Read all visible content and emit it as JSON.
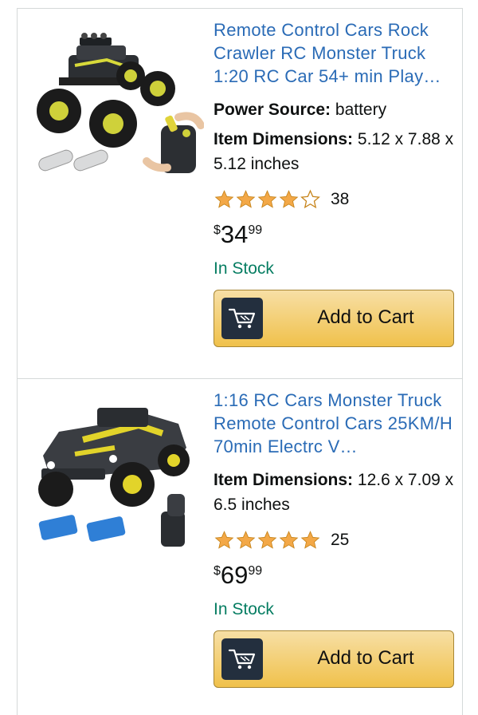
{
  "products": [
    {
      "title": "Remote Control Cars Rock Crawler RC Monster Truck 1:20 RC Car 54+ min Play…",
      "specs": [
        {
          "label": "Power Source:",
          "value": "battery"
        },
        {
          "label": "Item Dimensions:",
          "value": "5.12 x 7.88 x 5.12 inches"
        }
      ],
      "rating_stars": 4,
      "rating_count": "38",
      "price": {
        "currency": "$",
        "whole": "34",
        "fraction": "99"
      },
      "stock": "In Stock",
      "cart_label": "Add to Cart"
    },
    {
      "title": "1:16 RC Cars Monster Truck Remote Control Cars 25KM/H 70min Electrc V…",
      "specs": [
        {
          "label": "Item Dimensions:",
          "value": "12.6 x 7.09 x 6.5 inches"
        }
      ],
      "rating_stars": 5,
      "rating_count": "25",
      "price": {
        "currency": "$",
        "whole": "69",
        "fraction": "99"
      },
      "stock": "In Stock",
      "cart_label": "Add to Cart"
    }
  ],
  "colors": {
    "link": "#2a6bb6",
    "stock": "#067d62",
    "star": "#f3a847",
    "button": "#f0c14b",
    "cart_icon_bg": "#232f3e"
  }
}
